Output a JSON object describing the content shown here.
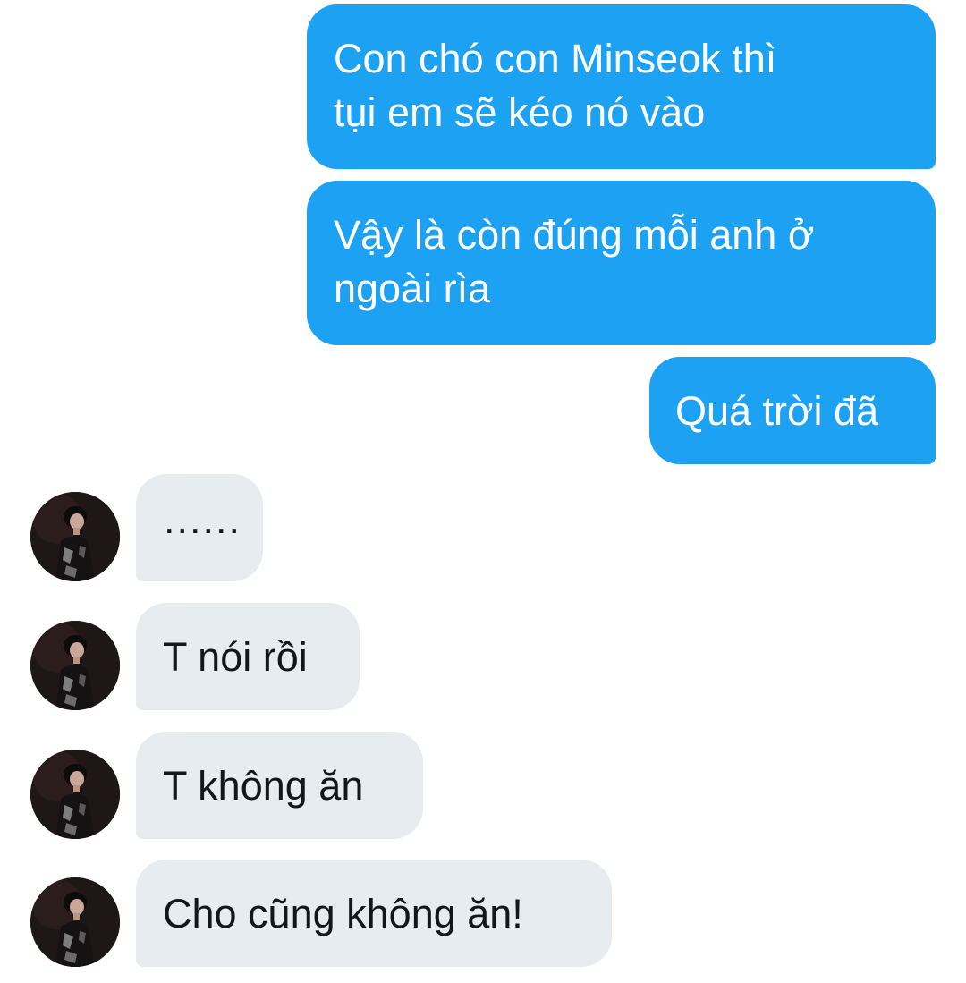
{
  "conversation": {
    "sent": [
      {
        "lines": [
          "Con chó con Minseok thì",
          "tụi em sẽ kéo nó vào"
        ]
      },
      {
        "lines": [
          "Vậy là còn đúng mỗi anh ở",
          "ngoài rìa"
        ]
      },
      {
        "lines": [
          "Quá trời đã"
        ]
      }
    ],
    "received": [
      {
        "text": "......"
      },
      {
        "text": "T nói rồi"
      },
      {
        "text": "T không ăn"
      },
      {
        "text": "Cho cũng không ăn!"
      }
    ]
  },
  "colors": {
    "sent_bubble": "#1da1f2",
    "received_bubble": "#e6ecf0",
    "sent_text": "#ffffff",
    "received_text": "#14171a"
  },
  "icons": {
    "avatar": "user-avatar-photo"
  }
}
